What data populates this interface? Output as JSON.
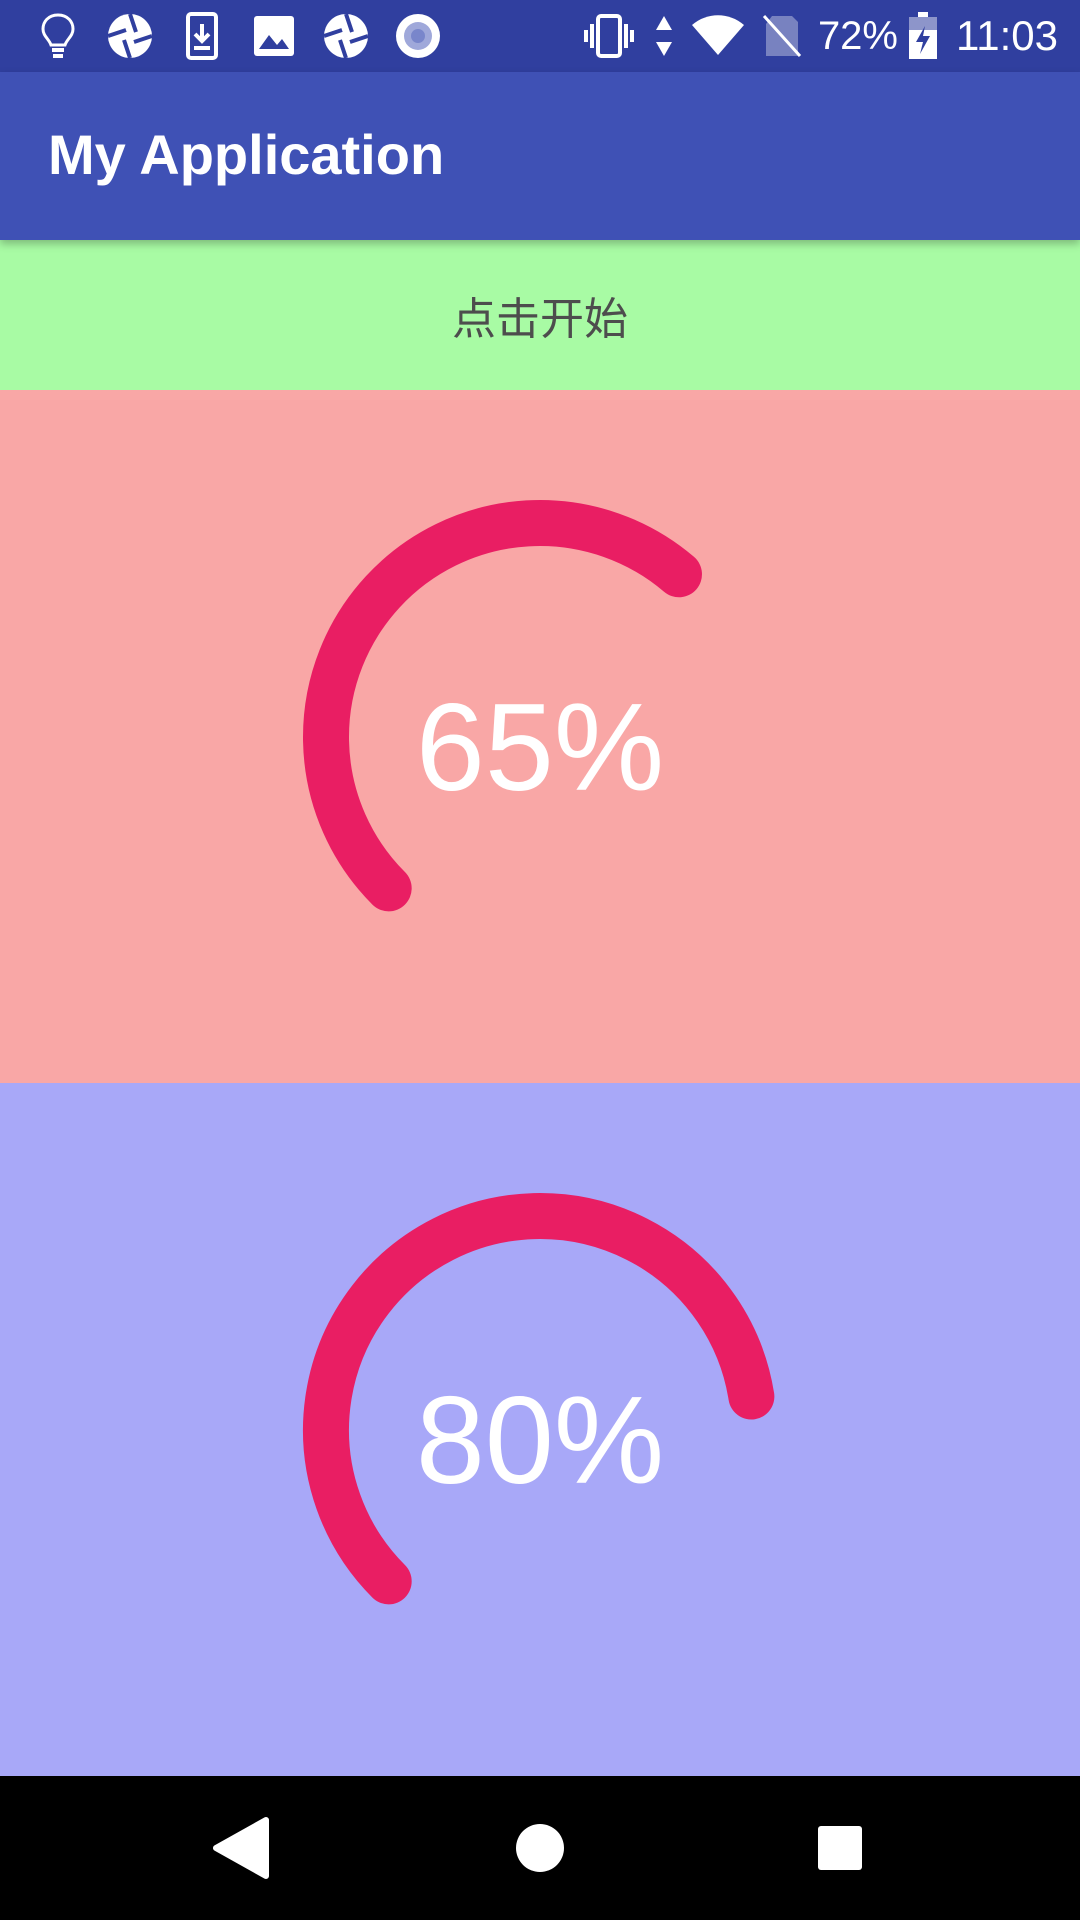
{
  "status_bar": {
    "battery_percent": "72%",
    "time": "11:03",
    "left_icons": [
      "lightbulb-icon",
      "aperture-icon",
      "download-icon",
      "image-icon",
      "aperture-icon",
      "record-icon"
    ],
    "right_icons": [
      "vibrate-icon",
      "data-arrows-icon",
      "wifi-icon",
      "no-sim-icon",
      "battery-charging-icon"
    ]
  },
  "app_bar": {
    "title": "My Application"
  },
  "start_button": {
    "label": "点击开始",
    "color": "#A8FBA4"
  },
  "progress_rings": [
    {
      "label": "65%",
      "value": 65,
      "background": "#F9A7A6",
      "arc_color": "#E91E63"
    },
    {
      "label": "80%",
      "value": 80,
      "background": "#A8A8F8",
      "arc_color": "#E91E63"
    }
  ],
  "nav_bar": {
    "icons": [
      "back-icon",
      "home-icon",
      "recents-icon"
    ]
  }
}
